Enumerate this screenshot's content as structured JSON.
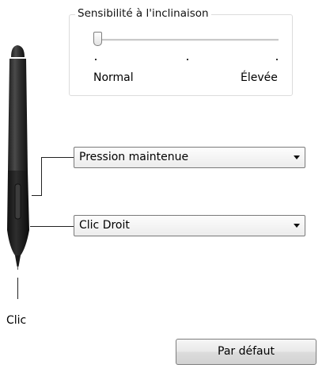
{
  "tilt": {
    "title": "Sensibilité à l'inclinaison",
    "min_label": "Normal",
    "max_label": "Élevée",
    "value": 0
  },
  "buttons": {
    "upper_label": "Pression maintenue",
    "lower_label": "Clic Droit"
  },
  "tip": {
    "label": "Clic"
  },
  "default_button_label": "Par défaut"
}
